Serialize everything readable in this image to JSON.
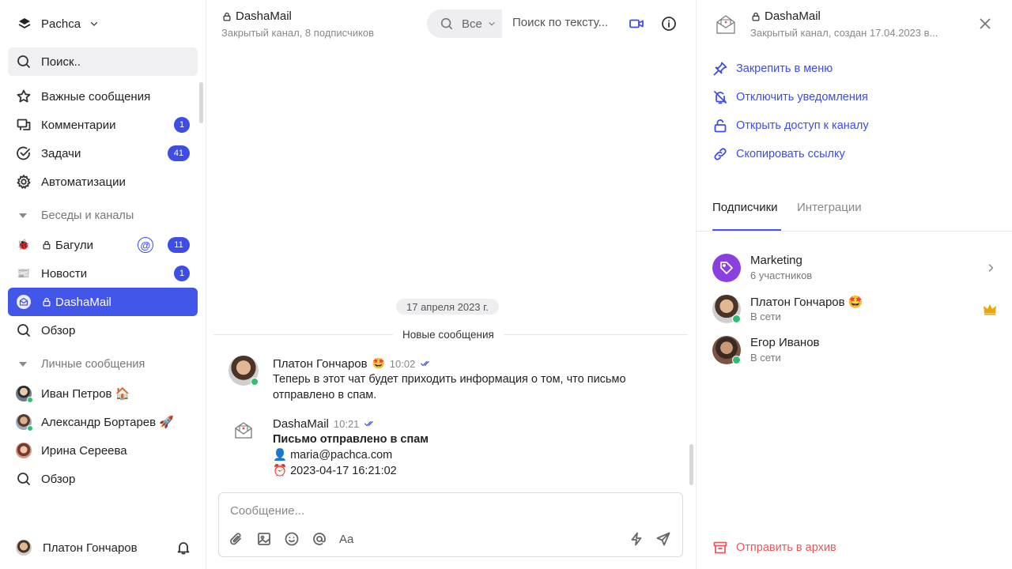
{
  "workspace": {
    "name": "Pachca"
  },
  "sidebar": {
    "search_placeholder": "Поиск..",
    "nav": [
      {
        "label": "Важные сообщения",
        "badge": ""
      },
      {
        "label": "Комментарии",
        "badge": "1"
      },
      {
        "label": "Задачи",
        "badge": "41"
      },
      {
        "label": "Автоматизации",
        "badge": ""
      }
    ],
    "channels_section": "Беседы и каналы",
    "channels": [
      {
        "label": "Багули",
        "badge": "11",
        "icon": "🐞"
      },
      {
        "label": "Новости",
        "badge": "1",
        "icon": "📰"
      },
      {
        "label": "DashaMail",
        "badge": ""
      },
      {
        "label": "Обзор",
        "badge": ""
      }
    ],
    "dm_section": "Личные сообщения",
    "dms": [
      {
        "label": "Иван Петров 🏠"
      },
      {
        "label": "Александр Бортарев 🚀"
      },
      {
        "label": "Ирина Сереева"
      },
      {
        "label": "Обзор"
      }
    ],
    "current_user": "Платон Гончаров"
  },
  "channel": {
    "title": "DashaMail",
    "subtitle": "Закрытый канал, 8 подписчиков",
    "filter_label": "Все",
    "search_placeholder": "Поиск по тексту..."
  },
  "messages_area": {
    "date_divider": "17 апреля 2023 г.",
    "new_messages_label": "Новые сообщения",
    "messages": [
      {
        "author": "Платон Гончаров",
        "status_emoji": "🤩",
        "time": "10:02",
        "text": "Теперь в этот чат будет приходить информация о том, что письмо отправлено в спам."
      },
      {
        "author": "DashaMail",
        "time": "10:21",
        "title": "Письмо отправлено в спам",
        "email": "👤 maria@pachca.com",
        "datetime": "⏰ 2023-04-17 16:21:02"
      }
    ]
  },
  "composer": {
    "placeholder": "Сообщение...",
    "format_label": "Aa"
  },
  "details": {
    "title": "DashaMail",
    "subtitle": "Закрытый канал, создан 17.04.2023 в...",
    "actions": [
      "Закрепить в меню",
      "Отключить уведомления",
      "Открыть доступ к каналу",
      "Скопировать ссылку"
    ],
    "tabs": [
      "Подписчики",
      "Интеграции"
    ],
    "members": [
      {
        "name": "Marketing",
        "sub": "6 участников"
      },
      {
        "name": "Платон Гончаров 🤩",
        "sub": "В сети"
      },
      {
        "name": "Егор Иванов",
        "sub": "В сети"
      }
    ],
    "archive_label": "Отправить в архив"
  },
  "colors": {
    "accent": "#4256ea",
    "danger": "#e35a5a",
    "online": "#2fbf71",
    "group": "#8a3fe0"
  }
}
